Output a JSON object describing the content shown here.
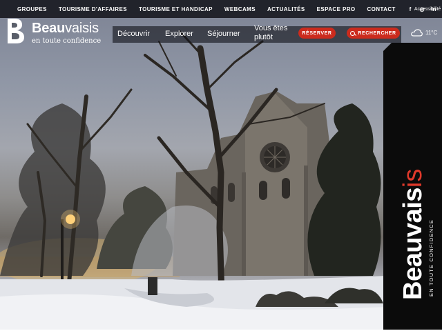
{
  "topbar": {
    "links": [
      "GROUPES",
      "TOURISME D'AFFAIRES",
      "TOURISME ET HANDICAP",
      "WEBCAMS",
      "ACTUALITÉS",
      "ESPACE PRO",
      "CONTACT"
    ],
    "accessibility_label": "Accessibilité",
    "socials": [
      "f",
      "◎",
      "in"
    ]
  },
  "logo": {
    "name_bold": "Beau",
    "name_light": "vaisis",
    "tagline": "en toute confidence"
  },
  "nav": {
    "decouvrir": "Découvrir",
    "explorer": "Explorer",
    "sejourner": "Séjourner",
    "vous_etes_line1": "Vous êtes",
    "vous_etes_line2": "plutôt",
    "reserver": "RÉSERVER",
    "rechercher": "RECHERCHER"
  },
  "weather": {
    "temperature": "11°C",
    "icon": "cloud-icon"
  },
  "brand_vertical": {
    "main": "Beauvais",
    "accent": "is",
    "tagline": "EN TOUTE CONFIDENCE"
  },
  "colors": {
    "accent": "#cc2b1d",
    "band": "#0b0b0b",
    "brand_red": "#e0392b"
  }
}
